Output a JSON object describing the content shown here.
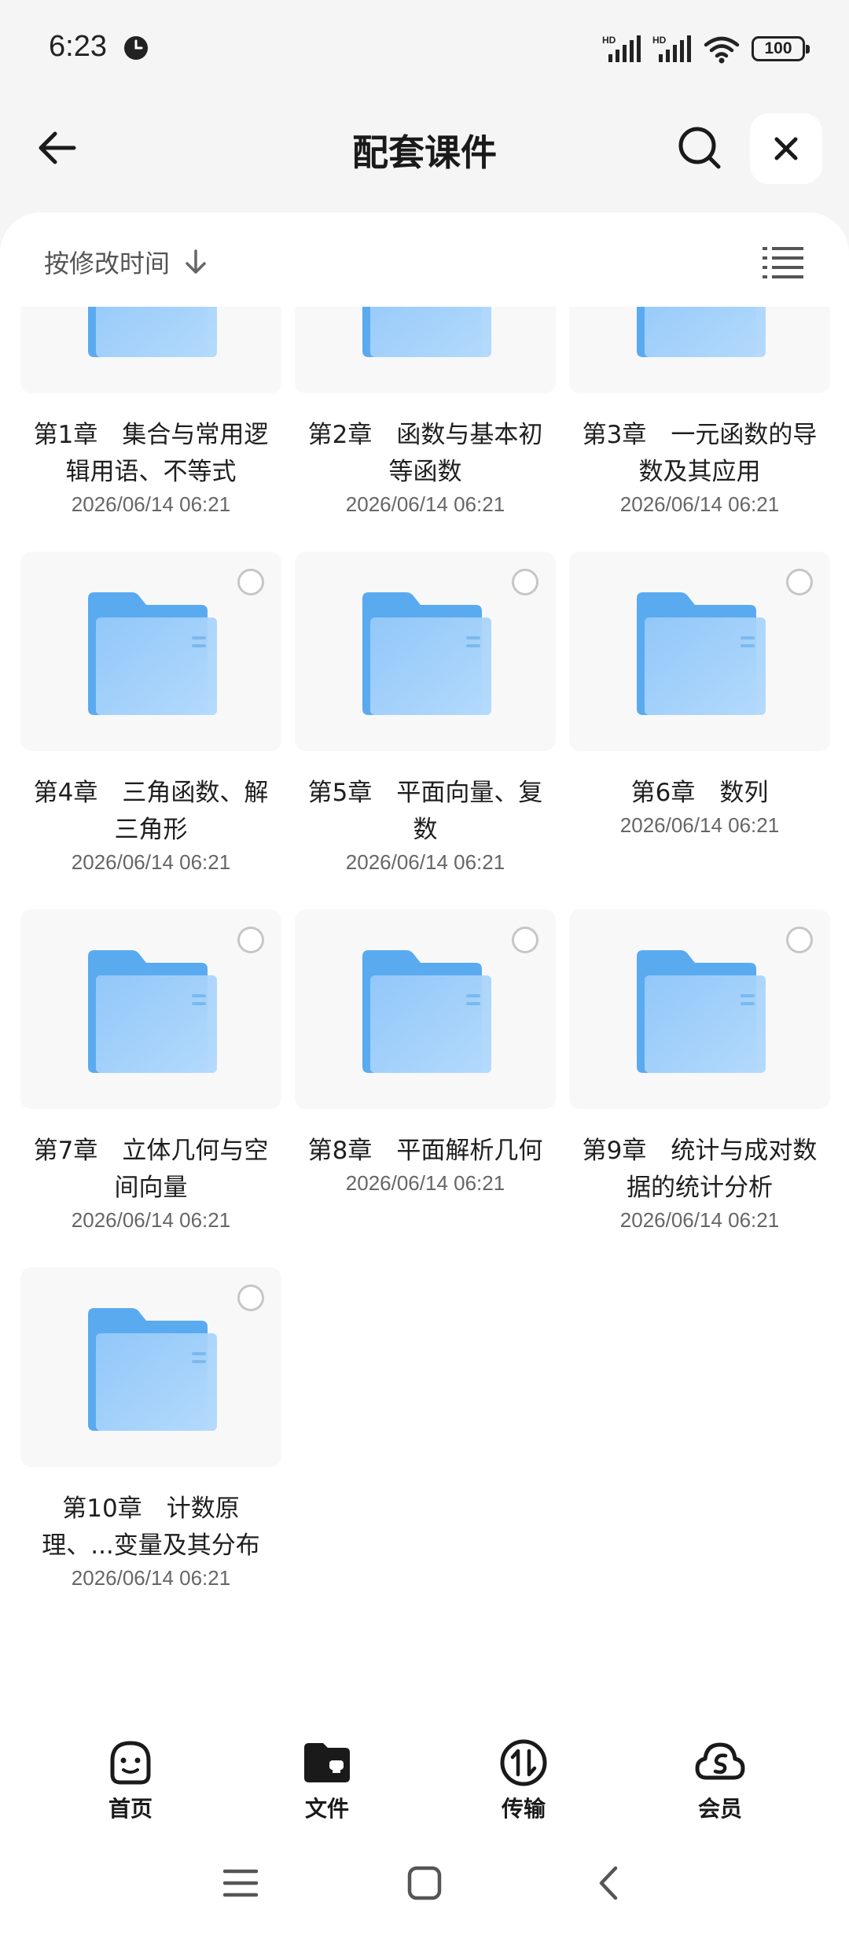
{
  "status_bar": {
    "time": "6:23",
    "battery": "100",
    "signal1_label": "HD",
    "signal2_label": "HD"
  },
  "header": {
    "title": "配套课件",
    "back_icon": "arrow-left-icon",
    "search_icon": "search-icon",
    "close_icon": "close-icon"
  },
  "sort": {
    "label": "按修改时间",
    "direction_icon": "arrow-down-icon",
    "view_icon": "list-view-icon"
  },
  "files": [
    {
      "name": "第1章　集合与常用逻辑用语、不等式",
      "date": "2026/06/14 06:21"
    },
    {
      "name": "第2章　函数与基本初等函数",
      "date": "2026/06/14 06:21"
    },
    {
      "name": "第3章　一元函数的导数及其应用",
      "date": "2026/06/14 06:21"
    },
    {
      "name": "第4章　三角函数、解三角形",
      "date": "2026/06/14 06:21"
    },
    {
      "name": "第5章　平面向量、复数",
      "date": "2026/06/14 06:21"
    },
    {
      "name": "第6章　数列",
      "date": "2026/06/14 06:21"
    },
    {
      "name": "第7章　立体几何与空间向量",
      "date": "2026/06/14 06:21"
    },
    {
      "name": "第8章　平面解析几何",
      "date": "2026/06/14 06:21"
    },
    {
      "name": "第9章　统计与成对数据的统计分析",
      "date": "2026/06/14 06:21"
    },
    {
      "name": "第10章　计数原理、...变量及其分布",
      "date": "2026/06/14 06:21"
    }
  ],
  "bottom_nav": [
    {
      "label": "首页",
      "icon": "home-face-icon"
    },
    {
      "label": "文件",
      "icon": "folder-icon"
    },
    {
      "label": "传输",
      "icon": "transfer-icon"
    },
    {
      "label": "会员",
      "icon": "vip-cloud-icon"
    }
  ],
  "colors": {
    "folder_back": "#5aaaf0",
    "folder_front": "#9ccdfa",
    "background": "#f5f5f6",
    "card": "#ffffff"
  }
}
